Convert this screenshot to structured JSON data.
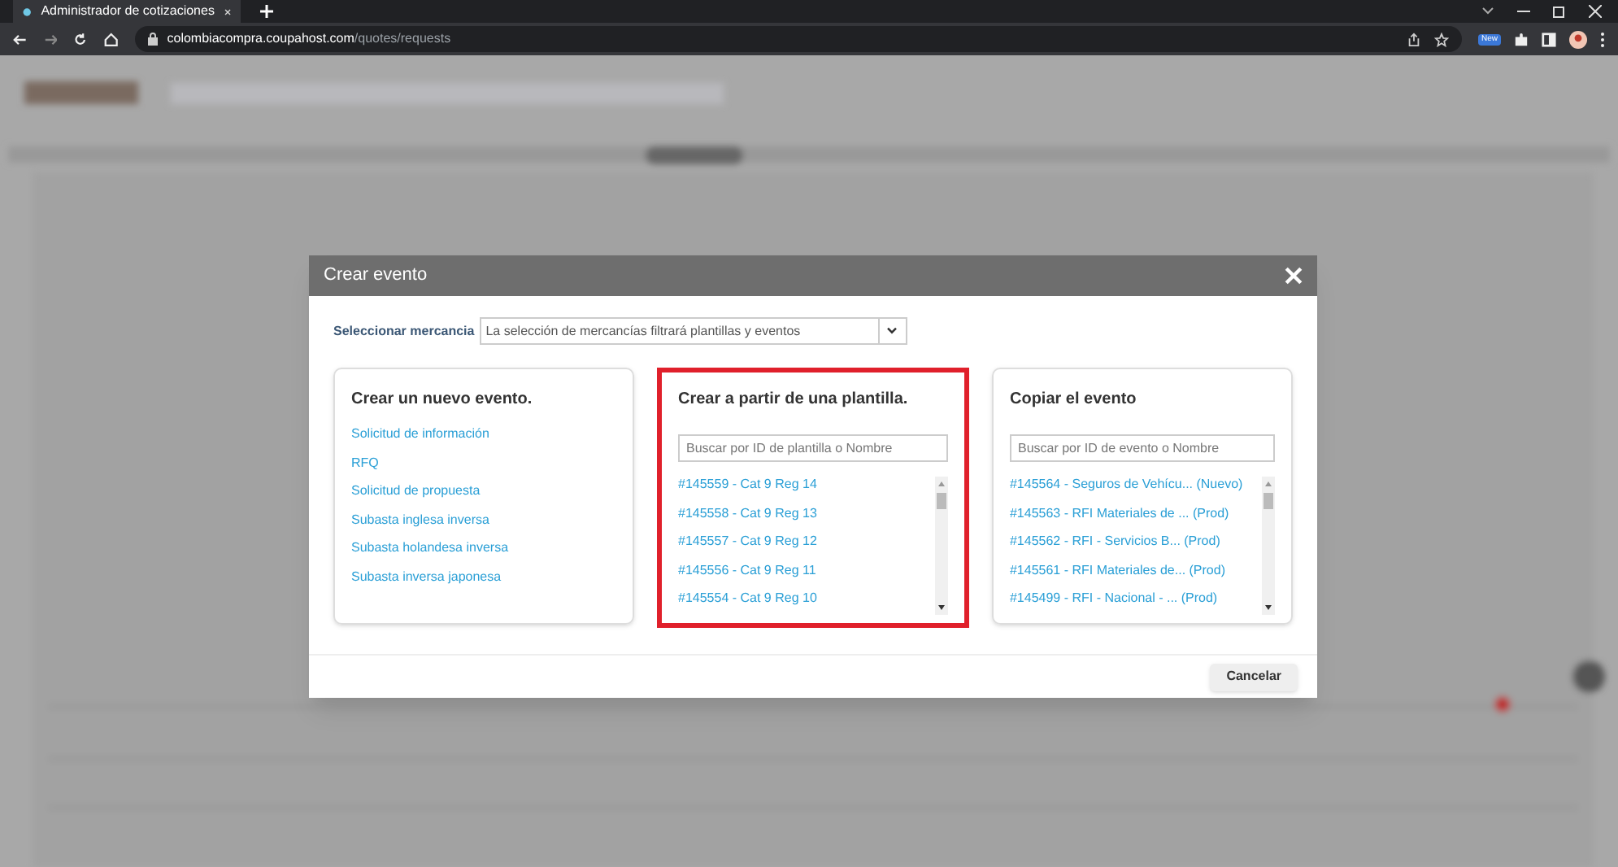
{
  "browser": {
    "tab_title": "Administrador de cotizaciones",
    "url_host": "colombiacompra.coupahost.com",
    "url_path": "/quotes/requests",
    "extension_badge": "New"
  },
  "modal": {
    "title": "Crear evento",
    "commodity": {
      "label": "Seleccionar mercancia",
      "placeholder": "La selección de mercancías filtrará plantillas y eventos"
    },
    "sections": [
      {
        "kind": "links",
        "title": "Crear un nuevo evento.",
        "highlighted": false,
        "items": [
          "Solicitud de información",
          "RFQ",
          "Solicitud de propuesta",
          "Subasta inglesa inversa",
          "Subasta holandesa inversa",
          "Subasta inversa japonesa"
        ]
      },
      {
        "kind": "search",
        "title": "Crear a partir de una plantilla.",
        "highlighted": true,
        "placeholder": "Buscar por ID de plantilla o Nombre",
        "items": [
          "#145559 - Cat 9 Reg 14",
          "#145558 - Cat 9 Reg 13",
          "#145557 - Cat 9 Reg 12",
          "#145556 - Cat 9 Reg 11",
          "#145554 - Cat 9 Reg 10"
        ]
      },
      {
        "kind": "search",
        "title": "Copiar el evento",
        "highlighted": false,
        "placeholder": "Buscar por ID de evento o Nombre",
        "items": [
          "#145564 - Seguros de Vehícu... (Nuevo)",
          "#145563 - RFI Materiales de ... (Prod)",
          "#145562 - RFI - Servicios B... (Prod)",
          "#145561 - RFI Materiales de... (Prod)",
          "#145499 - RFI - Nacional - ... (Prod)"
        ]
      }
    ],
    "cancel": "Cancelar"
  }
}
